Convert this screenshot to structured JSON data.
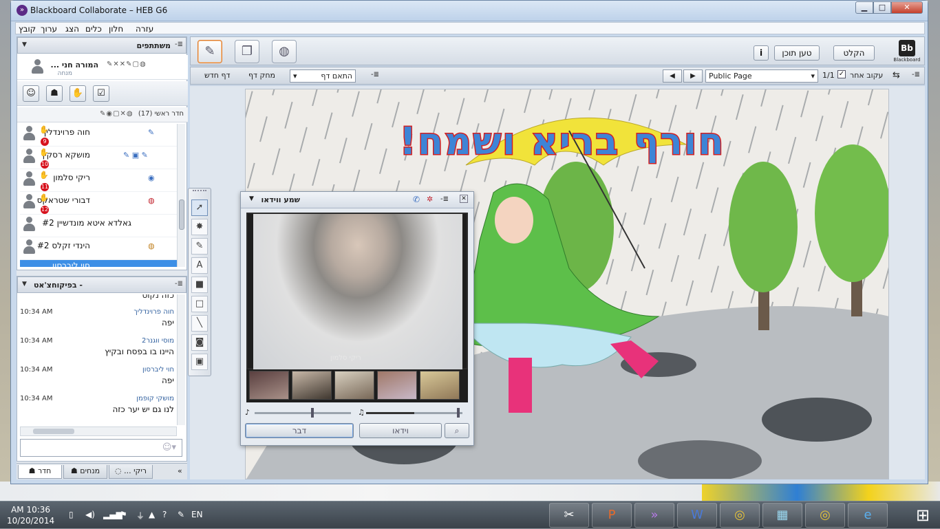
{
  "window": {
    "title": "Blackboard Collaborate – HEB G6",
    "min": "▁",
    "max": "□",
    "close": "✕"
  },
  "menu": [
    "עזרה",
    "חלון",
    "כלים",
    "הצג",
    "ערוך",
    "קובץ"
  ],
  "participants": {
    "title": "משתתפים",
    "moderator": {
      "name": "המורה חני ...",
      "role": "מנחה"
    },
    "room_label": "חדר ראשי (17)",
    "list": [
      {
        "name": "חוה פרוינדליך",
        "badge": "9",
        "hand": true
      },
      {
        "name": "מושקא רסקין",
        "badge": "10",
        "hand": true
      },
      {
        "name": "ריקי סלמון",
        "badge": "11",
        "hand": true
      },
      {
        "name": "דבורי שטראקס",
        "badge": "12",
        "hand": true
      },
      {
        "name": "גאלדא איטא מונדשיין #2",
        "badge": "",
        "hand": false
      },
      {
        "name": "הינדי זקלס #2",
        "badge": "",
        "hand": false
      },
      {
        "name": "חוי ליברסון",
        "badge": "",
        "hand": false,
        "selected": true
      }
    ]
  },
  "chat": {
    "title": "בפיקוחצ'אט -",
    "top_partial": "כזה נקוט",
    "messages": [
      {
        "sender": "חוה פרוינדליך",
        "time": "10:34 AM",
        "text": "יפה"
      },
      {
        "sender": "מוסי ווגנר2",
        "time": "10:34 AM",
        "text": "היינו בו בפסח ובקיץ"
      },
      {
        "sender": "חוי ליברסון",
        "time": "10:34 AM",
        "text": "יפה"
      },
      {
        "sender": "מושקי קופמן",
        "time": "10:34 AM",
        "text": "לנו גם יש יער כזה"
      }
    ]
  },
  "tabs": [
    {
      "label": "חדר"
    },
    {
      "label": "מנחים"
    },
    {
      "label": "ריקי ..."
    }
  ],
  "toolbar": {
    "record": "הקלט",
    "load_content": "טען תוכן",
    "info": "i",
    "bb_label": "Blackboard",
    "bb_mark": "Bb"
  },
  "whiteboard": {
    "new_page": "דף חדש",
    "delete_page": "מחק דף",
    "fit_page": "התאם דף",
    "page_select": "Public Page",
    "page_count": "1/1",
    "follow": "עקוב אחר"
  },
  "slide": {
    "title": "חורף בריא ושמח!"
  },
  "av": {
    "title": "שמע ווידאו",
    "video_name": "ריקי סלמון",
    "talk": "דבר",
    "video": "וידאו"
  },
  "taskbar": {
    "time": "AM 10:36",
    "date": "10/20/2014",
    "lang": "EN"
  },
  "colors": {
    "accent": "#3d8fe6",
    "badge": "#d7111c",
    "title_fill": "#3e84d6",
    "title_stroke": "#d42020"
  }
}
